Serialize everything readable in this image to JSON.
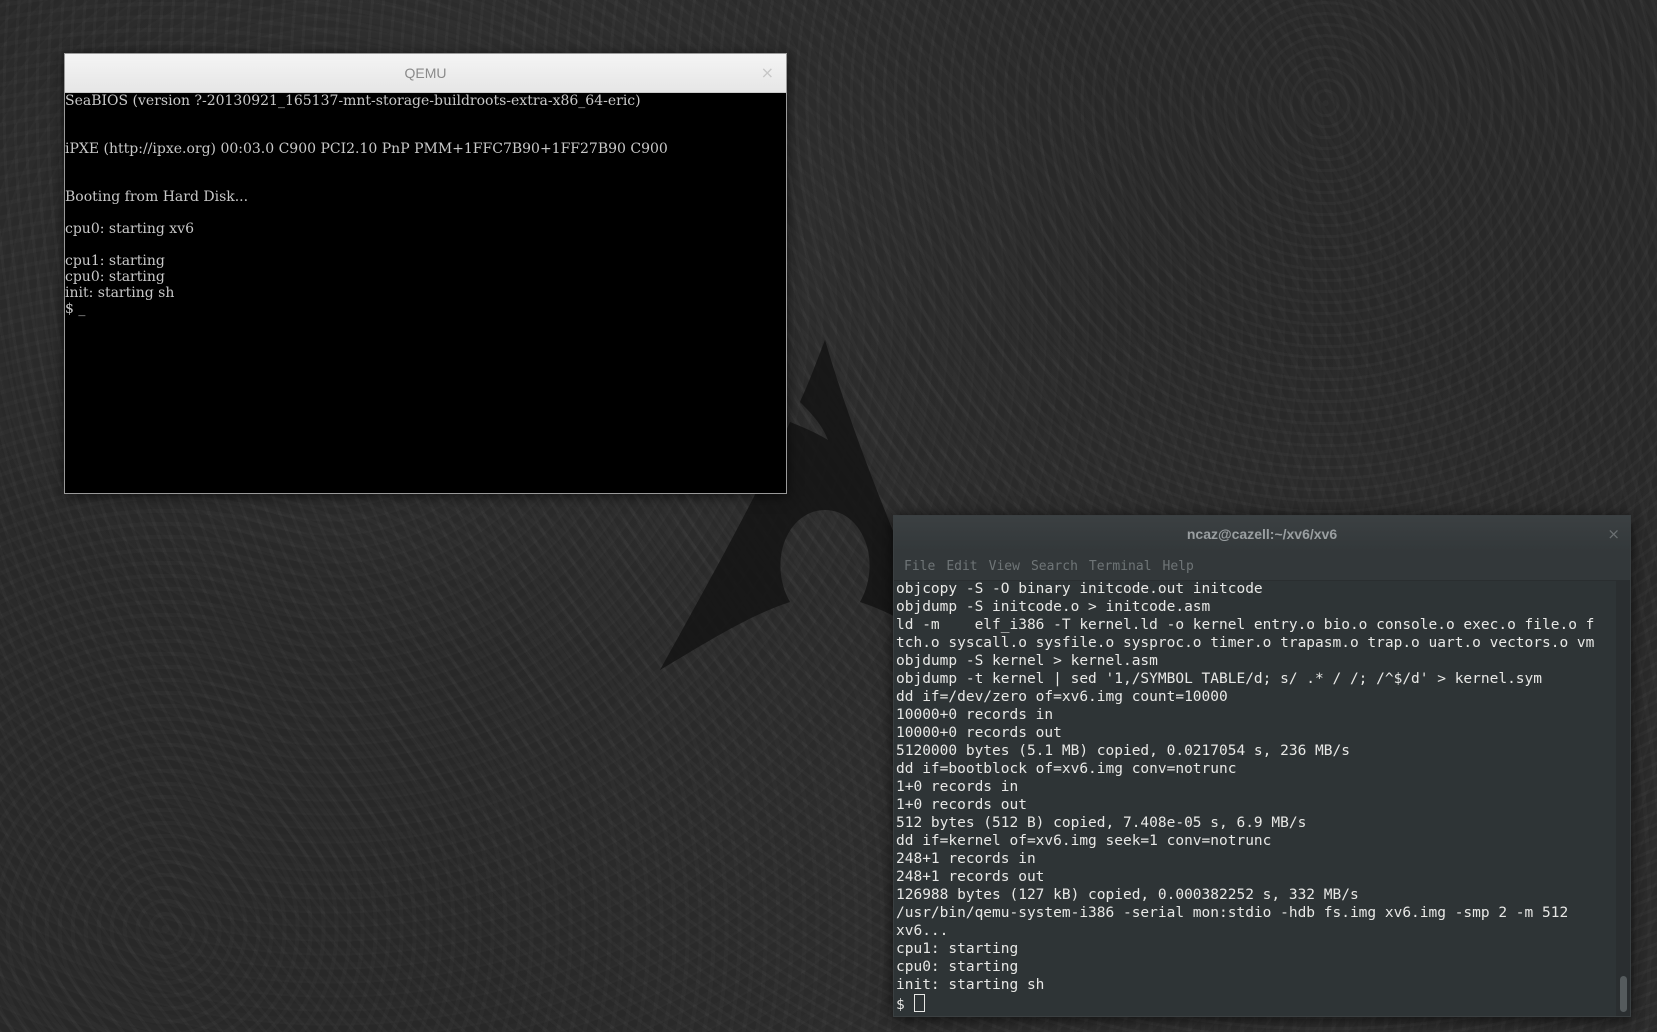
{
  "qemu": {
    "title": "QEMU",
    "close_glyph": "×",
    "screen_lines": [
      "SeaBIOS (version ?-20130921_165137-mnt-storage-buildroots-extra-x86_64-eric)",
      "",
      "",
      "iPXE (http://ipxe.org) 00:03.0 C900 PCI2.10 PnP PMM+1FFC7B90+1FF27B90 C900",
      "",
      "",
      "Booting from Hard Disk...",
      "",
      "cpu0: starting xv6",
      "",
      "cpu1: starting",
      "cpu0: starting",
      "init: starting sh",
      "$ _"
    ]
  },
  "terminal": {
    "title": "ncaz@cazell:~/xv6/xv6",
    "close_glyph": "×",
    "menu": [
      "File",
      "Edit",
      "View",
      "Search",
      "Terminal",
      "Help"
    ],
    "lines": [
      "objcopy -S -O binary initcode.out initcode",
      "objdump -S initcode.o > initcode.asm",
      "ld -m    elf_i386 -T kernel.ld -o kernel entry.o bio.o console.o exec.o file.o f",
      "tch.o syscall.o sysfile.o sysproc.o timer.o trapasm.o trap.o uart.o vectors.o vm",
      "objdump -S kernel > kernel.asm",
      "objdump -t kernel | sed '1,/SYMBOL TABLE/d; s/ .* / /; /^$/d' > kernel.sym",
      "dd if=/dev/zero of=xv6.img count=10000",
      "10000+0 records in",
      "10000+0 records out",
      "5120000 bytes (5.1 MB) copied, 0.0217054 s, 236 MB/s",
      "dd if=bootblock of=xv6.img conv=notrunc",
      "1+0 records in",
      "1+0 records out",
      "512 bytes (512 B) copied, 7.408e-05 s, 6.9 MB/s",
      "dd if=kernel of=xv6.img seek=1 conv=notrunc",
      "248+1 records in",
      "248+1 records out",
      "126988 bytes (127 kB) copied, 0.000382252 s, 332 MB/s",
      "/usr/bin/qemu-system-i386 -serial mon:stdio -hdb fs.img xv6.img -smp 2 -m 512",
      "xv6...",
      "cpu1: starting",
      "cpu0: starting",
      "init: starting sh"
    ],
    "prompt": "$ "
  }
}
